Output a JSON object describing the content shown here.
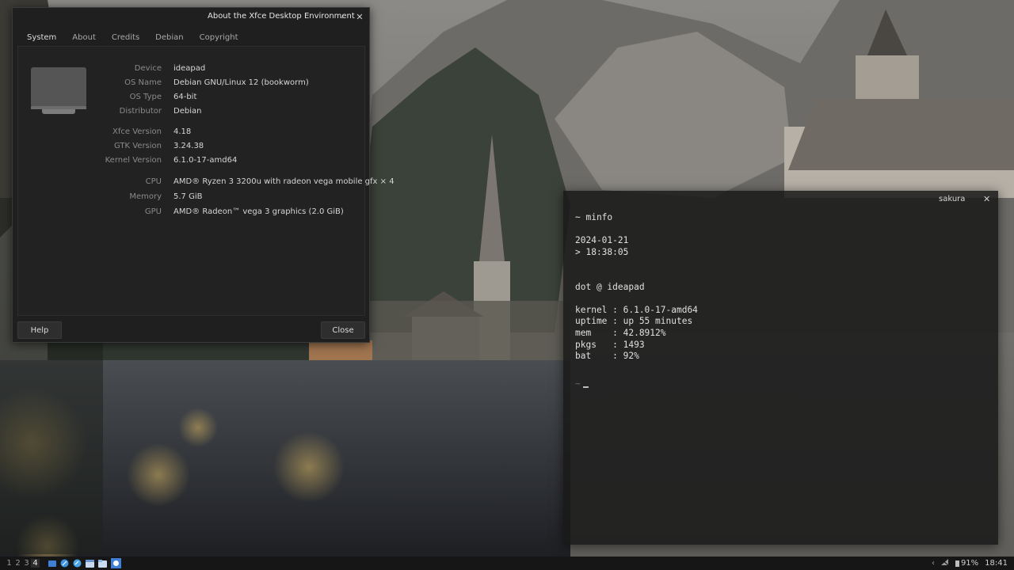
{
  "about_window": {
    "title": "About the Xfce Desktop Environment",
    "tabs": [
      "System",
      "About",
      "Credits",
      "Debian",
      "Copyright"
    ],
    "active_tab": "System",
    "info": [
      {
        "key": "Device",
        "value": "ideapad"
      },
      {
        "key": "OS Name",
        "value": "Debian GNU/Linux 12 (bookworm)"
      },
      {
        "key": "OS Type",
        "value": "64-bit"
      },
      {
        "key": "Distributor",
        "value": "Debian"
      },
      {
        "key": "Xfce Version",
        "value": "4.18"
      },
      {
        "key": "GTK Version",
        "value": "3.24.38"
      },
      {
        "key": "Kernel Version",
        "value": "6.1.0-17-amd64"
      },
      {
        "key": "CPU",
        "value": "AMD® Ryzen 3 3200u with radeon vega mobile gfx × 4"
      },
      {
        "key": "Memory",
        "value": "5.7 GiB"
      },
      {
        "key": "GPU",
        "value": "AMD® Radeon™ vega 3 graphics (2.0 GiB)"
      }
    ],
    "help_label": "Help",
    "close_label": "Close",
    "accent": "#3d7bd1"
  },
  "terminal": {
    "title": "sakura",
    "prompt_line": "~ minfo",
    "date": "2024-01-21",
    "time": "> 18:38:05",
    "user_host": "dot @ ideapad",
    "stats": [
      "kernel : 6.1.0-17-amd64",
      "uptime : up 55 minutes",
      "mem    : 42.8912%",
      "pkgs   : 1493",
      "bat    : 92%"
    ],
    "cursor_prompt": "~"
  },
  "panel": {
    "workspaces": [
      "1",
      "2",
      "3",
      "4"
    ],
    "active_workspace": "4",
    "launcher_icons": [
      "files-icon",
      "browser-icon",
      "settings-icon",
      "terminal-icon",
      "folder-icon",
      "app-icon"
    ],
    "battery": "91%",
    "clock": "18:41"
  }
}
